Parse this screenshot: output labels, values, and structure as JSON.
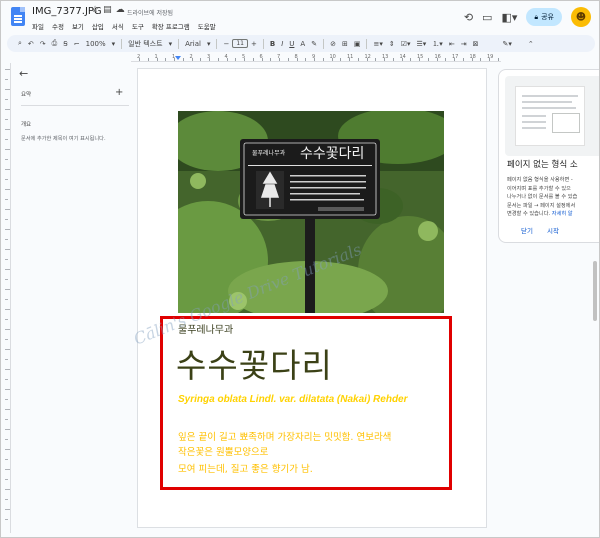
{
  "titlebar": {
    "doc_title": "IMG_7377.JPG",
    "save_status": "드라이브에 저장됨",
    "menu": [
      "파일",
      "수정",
      "보기",
      "삽입",
      "서식",
      "도구",
      "확장 프로그램",
      "도움말"
    ],
    "share_label": "공유"
  },
  "toolbar": {
    "zoom": "100%",
    "style": "일반 텍스트",
    "font": "Arial",
    "font_size": "11"
  },
  "ruler": {
    "numbers": [
      "2",
      "1",
      "1",
      "2",
      "3",
      "4",
      "5",
      "6",
      "7",
      "8",
      "9",
      "10",
      "11",
      "12",
      "13",
      "14",
      "15",
      "16",
      "17",
      "18",
      "19"
    ]
  },
  "outline": {
    "summary_label": "요약",
    "outline_label": "개요",
    "outline_hint": "문서에 추가한 제목이 여기 표시됩니다."
  },
  "document": {
    "family": "물푸레나무과",
    "korean_name": "수수꽃다리",
    "scientific_name": "Syringa oblata Lindl. var. dilatata (Nakai) Rehder",
    "description_lines": [
      "잎은 끝이 길고 뾰족하며 가장자리는 밋밋함. 연보라색",
      "작은꽃은 원뿔모양으로",
      "모여 피는데, 질고 좋은 향기가 남."
    ]
  },
  "sign": {
    "family": "물푸레나무과",
    "name": "수수꽃다리"
  },
  "watermark": "Cālin's Google Drive Tutorials",
  "side_panel": {
    "title": "페이지 없는 형식 소",
    "description_lines": [
      "페이지 없음 형식을 사용하면 -",
      "이어지며 표를 추가할 수 있으",
      "나누거나 없이 문서를 볼 수 있습",
      "문서는 파일 → 페이지 설정에서",
      "변경할 수 있습니다."
    ],
    "link_text": "자세히 알",
    "close_label": "닫기",
    "action_label": "시작"
  },
  "colors": {
    "highlight_border": "#e00000",
    "scientific_name": "#ffd200",
    "description": "#ffc000",
    "korean_name": "#3b4116",
    "share_button": "#c2e7ff"
  }
}
